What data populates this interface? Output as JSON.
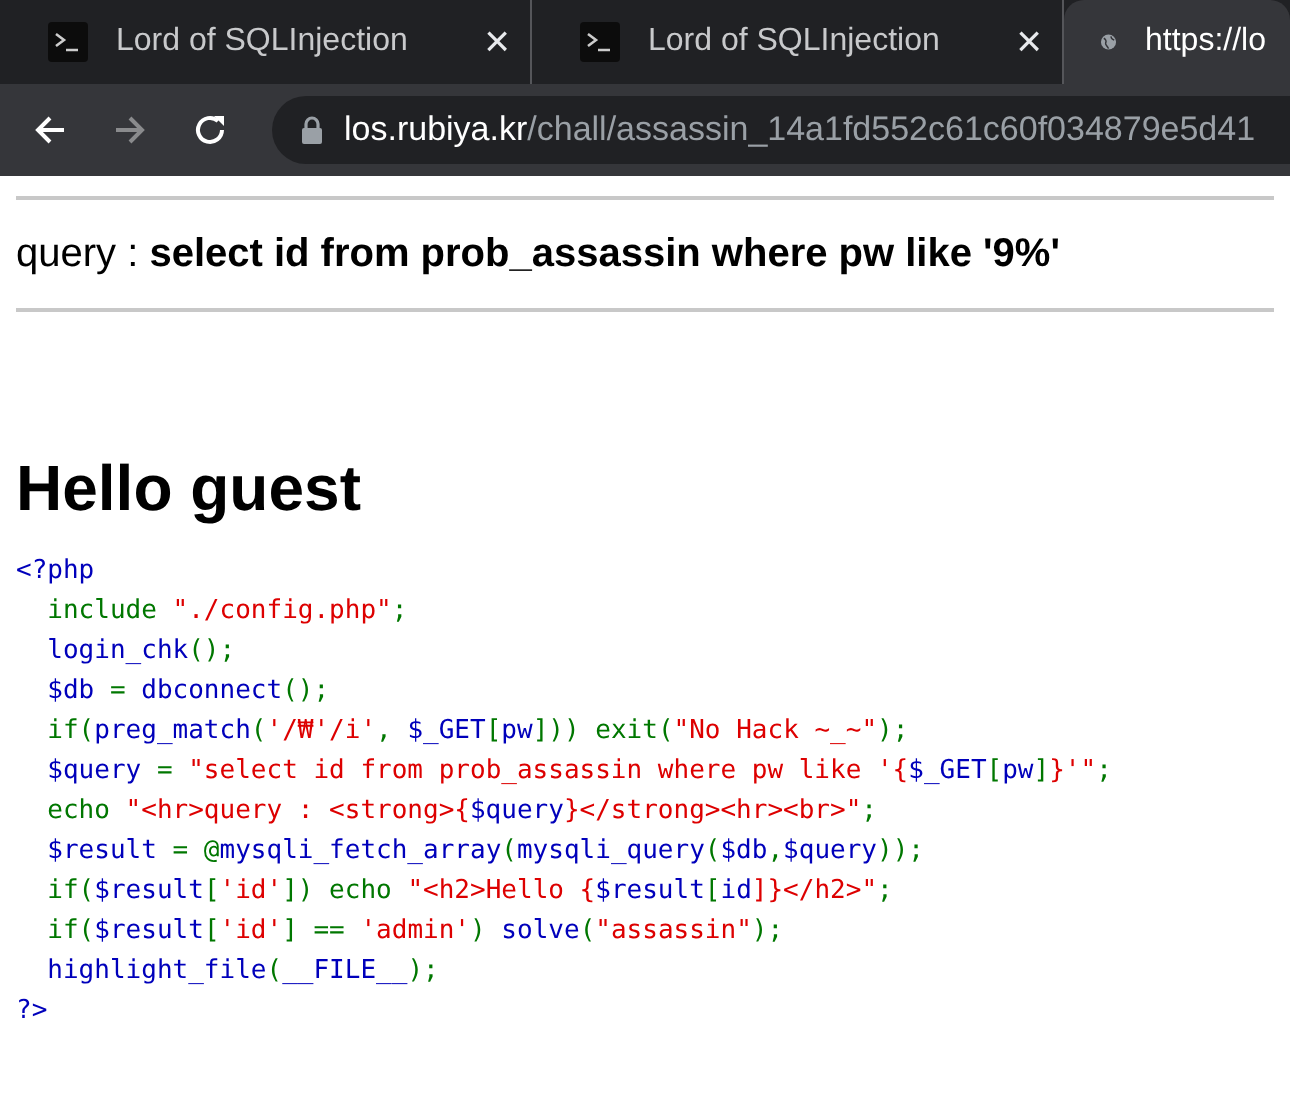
{
  "tabs": [
    {
      "title": "Lord of SQLInjection",
      "selected": false,
      "close": "×"
    },
    {
      "title": "Lord of SQLInjection",
      "selected": false,
      "close": "×"
    },
    {
      "title": "https://lo",
      "selected": true
    }
  ],
  "address_bar": {
    "host": "los.rubiya.kr",
    "path": "/chall/assassin_14a1fd552c61c60f034879e5d41"
  },
  "query_line": {
    "label": "query : ",
    "query": "select id from prob_assassin where pw like '9%'"
  },
  "heading": "Hello guest",
  "code_lines": [
    [
      {
        "text": "<?php",
        "color": "#0000bb"
      }
    ],
    [
      {
        "text": "  include ",
        "color": "#007700"
      },
      {
        "text": "\"./config.php\"",
        "color": "#dd0000"
      },
      {
        "text": ";",
        "color": "#007700"
      }
    ],
    [
      {
        "text": "  login_chk",
        "color": "#0000bb"
      },
      {
        "text": "();",
        "color": "#007700"
      }
    ],
    [
      {
        "text": "  $db ",
        "color": "#0000bb"
      },
      {
        "text": "= ",
        "color": "#007700"
      },
      {
        "text": "dbconnect",
        "color": "#0000bb"
      },
      {
        "text": "();",
        "color": "#007700"
      }
    ],
    [
      {
        "text": "  if(",
        "color": "#007700"
      },
      {
        "text": "preg_match",
        "color": "#0000bb"
      },
      {
        "text": "(",
        "color": "#007700"
      },
      {
        "text": "'/₩'/i'",
        "color": "#dd0000"
      },
      {
        "text": ", ",
        "color": "#007700"
      },
      {
        "text": "$_GET",
        "color": "#0000bb"
      },
      {
        "text": "[",
        "color": "#007700"
      },
      {
        "text": "pw",
        "color": "#0000bb"
      },
      {
        "text": "])) exit(",
        "color": "#007700"
      },
      {
        "text": "\"No Hack ~_~\"",
        "color": "#dd0000"
      },
      {
        "text": ");",
        "color": "#007700"
      }
    ],
    [
      {
        "text": "  $query ",
        "color": "#0000bb"
      },
      {
        "text": "= ",
        "color": "#007700"
      },
      {
        "text": "\"select id from prob_assassin where pw like '{",
        "color": "#dd0000"
      },
      {
        "text": "$_GET",
        "color": "#0000bb"
      },
      {
        "text": "[",
        "color": "#007700"
      },
      {
        "text": "pw",
        "color": "#0000bb"
      },
      {
        "text": "]",
        "color": "#007700"
      },
      {
        "text": "}'\"",
        "color": "#dd0000"
      },
      {
        "text": ";",
        "color": "#007700"
      }
    ],
    [
      {
        "text": "  echo ",
        "color": "#007700"
      },
      {
        "text": "\"<hr>query : <strong>{",
        "color": "#dd0000"
      },
      {
        "text": "$query",
        "color": "#0000bb"
      },
      {
        "text": "}</strong><hr><br>\"",
        "color": "#dd0000"
      },
      {
        "text": ";",
        "color": "#007700"
      }
    ],
    [
      {
        "text": "  $result ",
        "color": "#0000bb"
      },
      {
        "text": "= @",
        "color": "#007700"
      },
      {
        "text": "mysqli_fetch_array",
        "color": "#0000bb"
      },
      {
        "text": "(",
        "color": "#007700"
      },
      {
        "text": "mysqli_query",
        "color": "#0000bb"
      },
      {
        "text": "(",
        "color": "#007700"
      },
      {
        "text": "$db",
        "color": "#0000bb"
      },
      {
        "text": ",",
        "color": "#007700"
      },
      {
        "text": "$query",
        "color": "#0000bb"
      },
      {
        "text": "));",
        "color": "#007700"
      }
    ],
    [
      {
        "text": "  if(",
        "color": "#007700"
      },
      {
        "text": "$result",
        "color": "#0000bb"
      },
      {
        "text": "[",
        "color": "#007700"
      },
      {
        "text": "'id'",
        "color": "#dd0000"
      },
      {
        "text": "]) echo ",
        "color": "#007700"
      },
      {
        "text": "\"<h2>Hello {",
        "color": "#dd0000"
      },
      {
        "text": "$result",
        "color": "#0000bb"
      },
      {
        "text": "[",
        "color": "#007700"
      },
      {
        "text": "id",
        "color": "#0000bb"
      },
      {
        "text": "]}</h2>\"",
        "color": "#dd0000"
      },
      {
        "text": ";",
        "color": "#007700"
      }
    ],
    [
      {
        "text": "  if(",
        "color": "#007700"
      },
      {
        "text": "$result",
        "color": "#0000bb"
      },
      {
        "text": "[",
        "color": "#007700"
      },
      {
        "text": "'id'",
        "color": "#dd0000"
      },
      {
        "text": "] == ",
        "color": "#007700"
      },
      {
        "text": "'admin'",
        "color": "#dd0000"
      },
      {
        "text": ") ",
        "color": "#007700"
      },
      {
        "text": "solve",
        "color": "#0000bb"
      },
      {
        "text": "(",
        "color": "#007700"
      },
      {
        "text": "\"assassin\"",
        "color": "#dd0000"
      },
      {
        "text": ");",
        "color": "#007700"
      }
    ],
    [
      {
        "text": "  highlight_file",
        "color": "#0000bb"
      },
      {
        "text": "(",
        "color": "#007700"
      },
      {
        "text": "__FILE__",
        "color": "#0000bb"
      },
      {
        "text": ");",
        "color": "#007700"
      }
    ],
    [
      {
        "text": "?>",
        "color": "#0000bb"
      }
    ]
  ]
}
